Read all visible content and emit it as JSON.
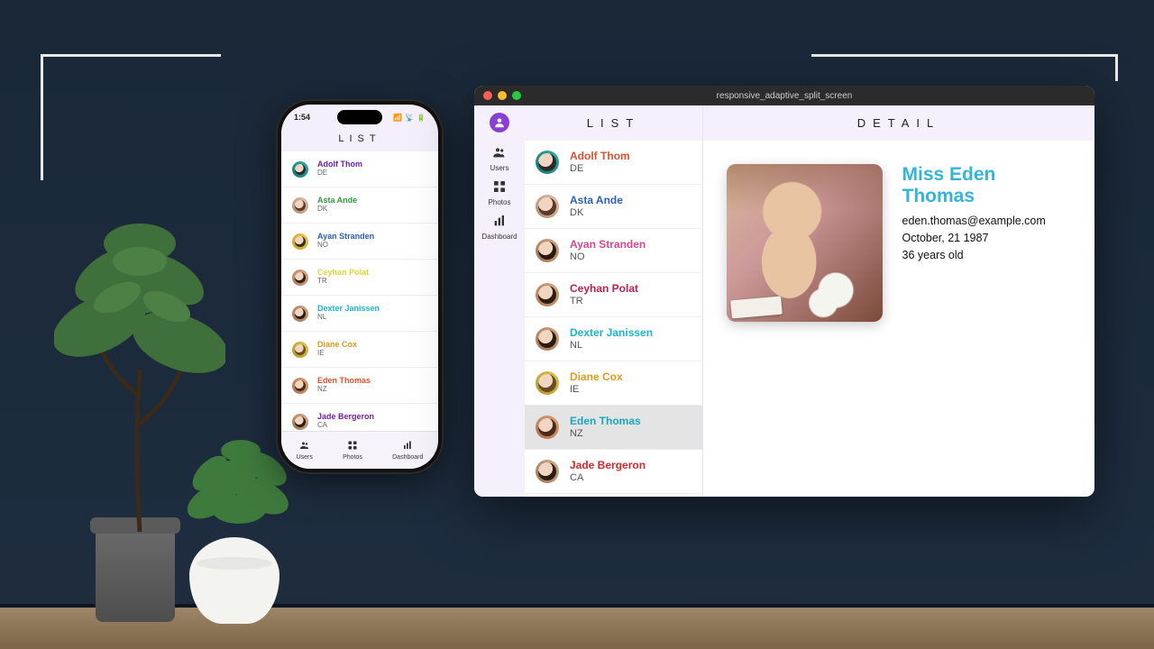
{
  "decor": {
    "floor": true
  },
  "phone": {
    "status_time": "1:54",
    "header": "LIST",
    "tabs": [
      {
        "label": "Users",
        "icon": "users-icon"
      },
      {
        "label": "Photos",
        "icon": "grid-icon"
      },
      {
        "label": "Dashboard",
        "icon": "chart-icon"
      }
    ],
    "rows": [
      {
        "name": "Adolf Thom",
        "cc": "DE",
        "color": "#6a1fb0",
        "c1": "#2aa6a0",
        "c2": "#1c7c78",
        "h": "#2a2a2a"
      },
      {
        "name": "Asta Ande",
        "cc": "DK",
        "color": "#2e9d3a",
        "c1": "#d9b9a3",
        "c2": "#b5917a",
        "h": "#5a3a28"
      },
      {
        "name": "Ayan Stranden",
        "cc": "NO",
        "color": "#2b5fb8",
        "c1": "#e7c44a",
        "c2": "#caa62f",
        "h": "#3b2a18"
      },
      {
        "name": "Ceyhan Polat",
        "cc": "TR",
        "color": "#e3d23a",
        "c1": "#d2a27e",
        "c2": "#b07f5a",
        "h": "#2f1e12"
      },
      {
        "name": "Dexter Janissen",
        "cc": "NL",
        "color": "#19b5ce",
        "c1": "#c9a07d",
        "c2": "#a77a55",
        "h": "#2a1a10"
      },
      {
        "name": "Diane Cox",
        "cc": "IE",
        "color": "#e09a1e",
        "c1": "#d8c04a",
        "c2": "#b89a2e",
        "h": "#6a4a20"
      },
      {
        "name": "Eden Thomas",
        "cc": "NZ",
        "color": "#e0502e",
        "c1": "#d79b78",
        "c2": "#b57450",
        "h": "#4a2a18"
      },
      {
        "name": "Jade Bergeron",
        "cc": "CA",
        "color": "#7a1fa2",
        "c1": "#caa68a",
        "c2": "#9f7a5a",
        "h": "#2d1c10"
      }
    ]
  },
  "window": {
    "title": "responsive_adaptive_split_screen",
    "list_header": "LIST",
    "detail_header": "DETAIL",
    "sidebar": [
      {
        "label": "Users",
        "icon": "users-icon"
      },
      {
        "label": "Photos",
        "icon": "grid-icon"
      },
      {
        "label": "Dashboard",
        "icon": "chart-icon"
      }
    ],
    "rows": [
      {
        "name": "Adolf Thom",
        "cc": "DE",
        "color": "#e0502e",
        "c1": "#2aa6a0",
        "c2": "#1c7c78",
        "h": "#2a2a2a",
        "selected": false
      },
      {
        "name": "Asta Ande",
        "cc": "DK",
        "color": "#2b5fb8",
        "c1": "#d9b9a3",
        "c2": "#b5917a",
        "h": "#5a3a28",
        "selected": false
      },
      {
        "name": "Ayan Stranden",
        "cc": "NO",
        "color": "#d64a8c",
        "c1": "#c9a07d",
        "c2": "#a77a55",
        "h": "#2a1a10",
        "selected": false
      },
      {
        "name": "Ceyhan Polat",
        "cc": "TR",
        "color": "#c21f4a",
        "c1": "#d2a27e",
        "c2": "#b07f5a",
        "h": "#2f1e12",
        "selected": false
      },
      {
        "name": "Dexter Janissen",
        "cc": "NL",
        "color": "#19b5ce",
        "c1": "#c9a07d",
        "c2": "#a77a55",
        "h": "#2a1a10",
        "selected": false
      },
      {
        "name": "Diane Cox",
        "cc": "IE",
        "color": "#e09a1e",
        "c1": "#d8c04a",
        "c2": "#b89a2e",
        "h": "#6a4a20",
        "selected": false
      },
      {
        "name": "Eden Thomas",
        "cc": "NZ",
        "color": "#1aa7bd",
        "c1": "#d79b78",
        "c2": "#b57450",
        "h": "#4a2a18",
        "selected": true
      },
      {
        "name": "Jade Bergeron",
        "cc": "CA",
        "color": "#d4262b",
        "c1": "#caa68a",
        "c2": "#9f7a5a",
        "h": "#2d1c10",
        "selected": false
      }
    ],
    "detail": {
      "title": "Miss Eden Thomas",
      "email": "eden.thomas@example.com",
      "dob": "October, 21 1987",
      "age": "36 years old"
    }
  }
}
